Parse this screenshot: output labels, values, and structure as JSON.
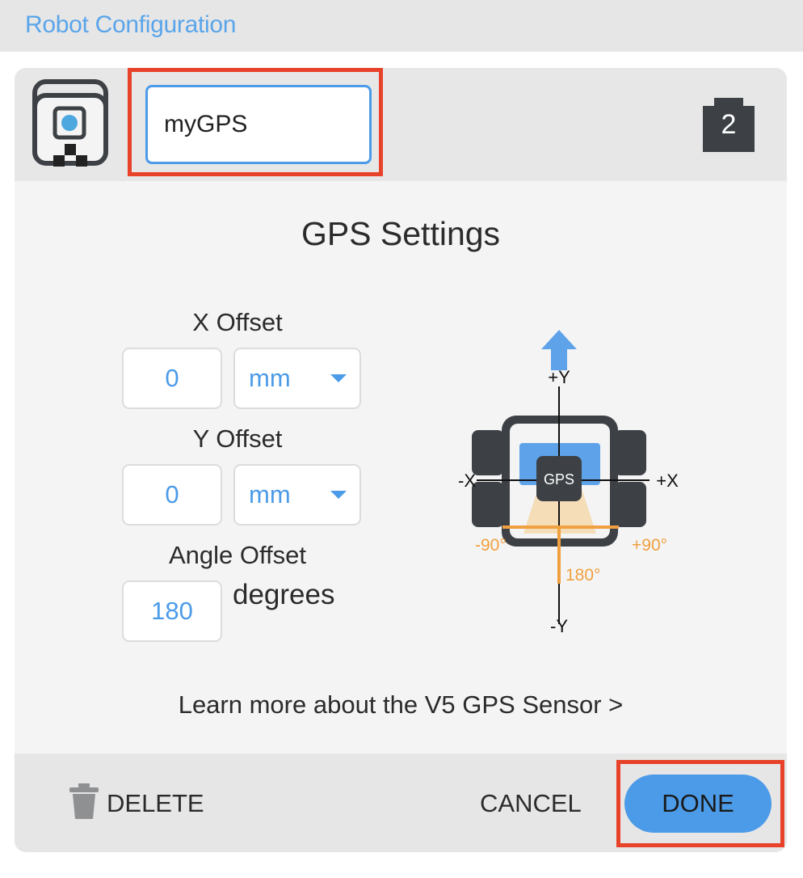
{
  "app": {
    "title": "Robot Configuration"
  },
  "device": {
    "name_value": "myGPS",
    "icon": "gps-sensor-icon",
    "port": "2"
  },
  "settings": {
    "title": "GPS Settings",
    "x_offset": {
      "label": "X Offset",
      "value": "0",
      "unit": "mm"
    },
    "y_offset": {
      "label": "Y Offset",
      "value": "0",
      "unit": "mm"
    },
    "angle_offset": {
      "label": "Angle Offset",
      "value": "180",
      "unit": "degrees"
    }
  },
  "diagram": {
    "plus_y": "+Y",
    "minus_y": "-Y",
    "plus_x": "+X",
    "minus_x": "-X",
    "sensor": "GPS",
    "neg90": "-90°",
    "pos90": "+90°",
    "deg180": "180°"
  },
  "learn_more": "Learn more about the V5 GPS Sensor >",
  "footer": {
    "delete_label": "DELETE",
    "cancel_label": "CANCEL",
    "done_label": "DONE"
  },
  "colors": {
    "accent": "#4c9be8",
    "highlight": "#e8432a",
    "orange": "#f0a040",
    "dark": "#3d4145"
  }
}
